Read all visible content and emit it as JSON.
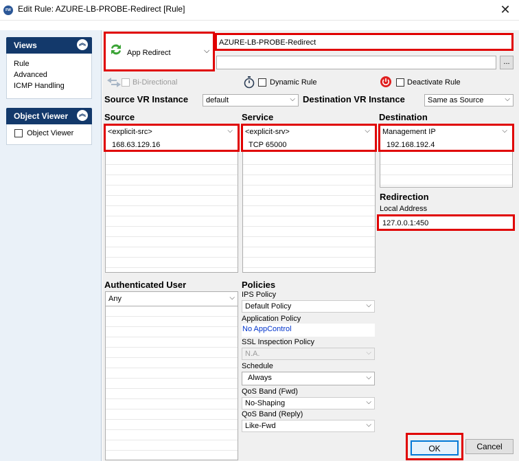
{
  "window": {
    "title": "Edit Rule: AZURE-LB-PROBE-Redirect [Rule]",
    "app_icon_text": "FW"
  },
  "sidebar": {
    "views": {
      "title": "Views",
      "items": [
        "Rule",
        "Advanced",
        "ICMP Handling"
      ]
    },
    "object_viewer": {
      "title": "Object Viewer",
      "checkbox_label": "Object Viewer"
    }
  },
  "rule": {
    "action": "App Redirect",
    "name": "AZURE-LB-PROBE-Redirect",
    "description": "",
    "bi_directional_label": "Bi-Directional",
    "dynamic_rule_label": "Dynamic Rule",
    "deactivate_rule_label": "Deactivate Rule"
  },
  "vr": {
    "source_label": "Source VR Instance",
    "source_value": "default",
    "destination_label": "Destination VR Instance",
    "destination_value": "Same as Source"
  },
  "source": {
    "label": "Source",
    "type": "<explicit-src>",
    "value": "168.63.129.16"
  },
  "service": {
    "label": "Service",
    "type": "<explicit-srv>",
    "value": "TCP  65000"
  },
  "destination": {
    "label": "Destination",
    "type": "Management IP",
    "value": "192.168.192.4"
  },
  "redirection": {
    "label": "Redirection",
    "local_address_label": "Local Address",
    "local_address": "127.0.0.1:450"
  },
  "auth_user": {
    "label": "Authenticated User",
    "value": "Any"
  },
  "policies": {
    "label": "Policies",
    "ips_label": "IPS Policy",
    "ips_value": "Default Policy",
    "app_label": "Application Policy",
    "app_value": "No AppControl",
    "ssl_label": "SSL Inspection Policy",
    "ssl_value": "N.A.",
    "schedule_label": "Schedule",
    "schedule_value": "Always",
    "qos_fwd_label": "QoS Band (Fwd)",
    "qos_fwd_value": "No-Shaping",
    "qos_reply_label": "QoS Band (Reply)",
    "qos_reply_value": "Like-Fwd"
  },
  "buttons": {
    "ok": "OK",
    "cancel": "Cancel",
    "ellipsis": "..."
  },
  "colors": {
    "highlight": "#e00000",
    "panel_header": "#13396b",
    "link_blue": "#0033cc"
  }
}
